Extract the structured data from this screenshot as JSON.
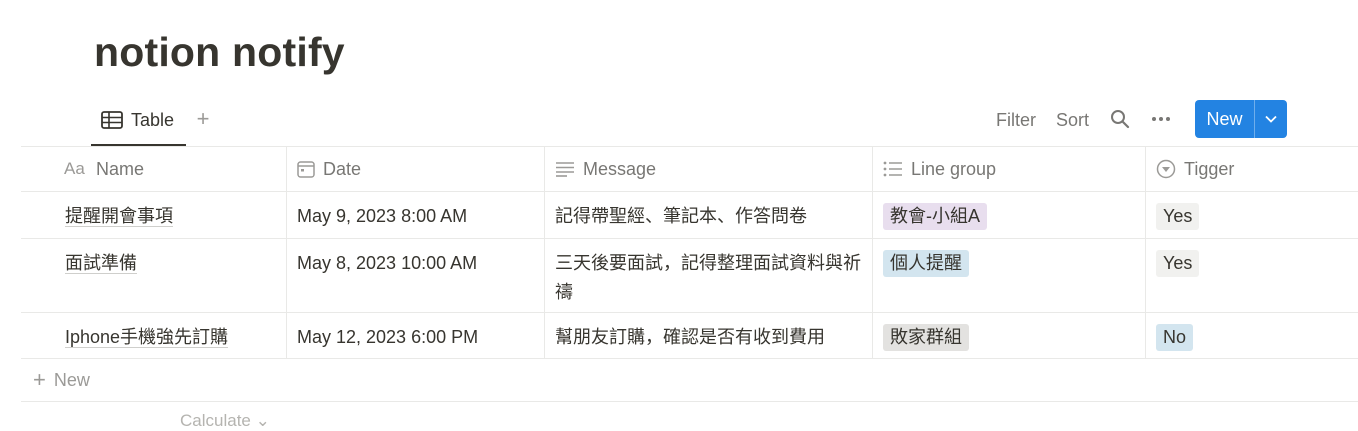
{
  "page": {
    "title": "notion notify"
  },
  "view": {
    "tab_label": "Table",
    "add_view": "+",
    "filter_label": "Filter",
    "sort_label": "Sort",
    "new_label": "New"
  },
  "table": {
    "columns": [
      {
        "icon": "text-property-icon",
        "label": "Name",
        "icon_text": "Aa"
      },
      {
        "icon": "calendar-icon",
        "label": "Date"
      },
      {
        "icon": "text-lines-icon",
        "label": "Message"
      },
      {
        "icon": "list-icon",
        "label": "Line group"
      },
      {
        "icon": "select-circle-icon",
        "label": "Tigger"
      }
    ],
    "rows": [
      {
        "name": "提醒開會事項",
        "date": "May 9, 2023 8:00 AM",
        "message": "記得帶聖經、筆記本、作答問卷",
        "line_group": "教會-小組A",
        "tigger": "Yes"
      },
      {
        "name": "面試準備",
        "date": "May 8, 2023 10:00 AM",
        "message": "三天後要面試，記得整理面試資料與祈禱",
        "line_group": "個人提醒",
        "tigger": "Yes"
      },
      {
        "name": "Iphone手機強先訂購",
        "date": "May 12, 2023 6:00 PM",
        "message": "幫朋友訂購，確認是否有收到費用",
        "line_group": "敗家群組",
        "tigger": "No"
      }
    ],
    "new_row_label": "New",
    "calculate_label": "Calculate"
  },
  "colors": {
    "accent": "#2383e2",
    "tag_purple": "#e8deee",
    "tag_blue": "#d3e5ef",
    "tag_gray": "#e3e2e0",
    "tag_light": "#f1f1ef"
  }
}
